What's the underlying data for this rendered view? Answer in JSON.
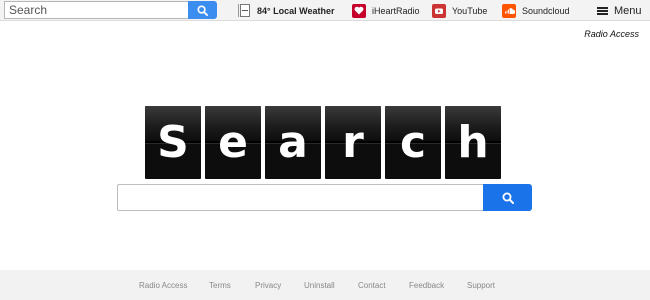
{
  "toolbar": {
    "search_placeholder": "Search",
    "weather_label": "84° Local Weather",
    "links": [
      {
        "label": "iHeartRadio",
        "icon": "iheartradio-icon",
        "color": "#c6002b"
      },
      {
        "label": "YouTube",
        "icon": "youtube-icon",
        "color": "#cc3333"
      },
      {
        "label": "Soundcloud",
        "icon": "soundcloud-icon",
        "color": "#ff5500"
      }
    ],
    "menu_label": "Menu"
  },
  "brand_label": "Radio Access",
  "logo_letters": [
    "S",
    "e",
    "a",
    "r",
    "c",
    "h"
  ],
  "main_search": {
    "placeholder": ""
  },
  "footer": {
    "links": [
      "Radio Access",
      "Terms",
      "Privacy",
      "Uninstall",
      "Contact",
      "Feedback",
      "Support"
    ]
  },
  "colors": {
    "toolbar_search_button": "#3b8ef0",
    "main_search_button": "#1a73e8",
    "footer_bg": "#f2f2f2"
  }
}
